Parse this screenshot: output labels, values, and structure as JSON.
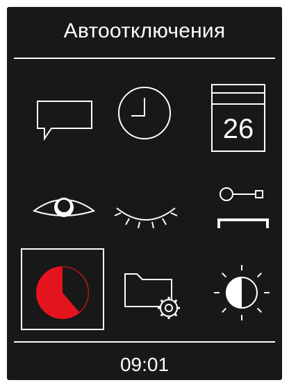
{
  "header": {
    "title": "Автоотключения"
  },
  "grid": {
    "items": [
      {
        "name": "message",
        "icon": "speech-bubble-icon"
      },
      {
        "name": "clock",
        "icon": "clock-icon"
      },
      {
        "name": "calendar",
        "icon": "calendar-icon",
        "label": "26"
      },
      {
        "name": "eye-open",
        "icon": "open-eye-icon"
      },
      {
        "name": "eye-closed",
        "icon": "closed-eye-icon"
      },
      {
        "name": "key-lock",
        "icon": "key-icon"
      },
      {
        "name": "timer",
        "icon": "pie-timer-icon",
        "selected": true
      },
      {
        "name": "folder-settings",
        "icon": "folder-gear-icon"
      },
      {
        "name": "brightness",
        "icon": "brightness-icon"
      }
    ]
  },
  "footer": {
    "time": "09:01"
  },
  "colors": {
    "background": "#181818",
    "foreground": "#ffffff",
    "accent": "#e3141e"
  }
}
